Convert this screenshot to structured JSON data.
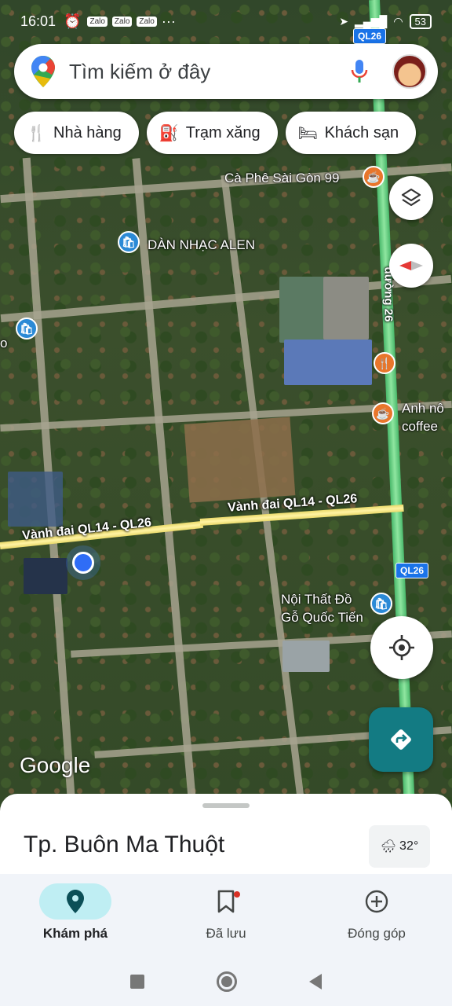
{
  "status_bar": {
    "time": "16:01",
    "apps": [
      "Zalo",
      "Zalo",
      "Zalo"
    ],
    "more": "···",
    "battery": "53"
  },
  "search": {
    "placeholder": "Tìm kiếm ở đây"
  },
  "chips": [
    {
      "label": "Nhà hàng",
      "icon": "restaurant-icon"
    },
    {
      "label": "Trạm xăng",
      "icon": "gas-station-icon"
    },
    {
      "label": "Khách sạn",
      "icon": "hotel-icon"
    }
  ],
  "map": {
    "places": {
      "cafe_saigon": "Cà Phê Sài Gòn 99",
      "dan_nhac": "DÀN NHẠC ALEN",
      "anh_no_1": "Anh nô",
      "anh_no_2": "coffee",
      "noi_that_1": "Nội Thất Đồ",
      "noi_that_2": "Gỗ Quốc Tiến",
      "left_cut": "o"
    },
    "roads": {
      "ring_left": "Vành đai QL14 - QL26",
      "ring_right": "Vành đai QL14 - QL26",
      "duong26": "đường 26",
      "ql26_top": "QL26",
      "ql26_bottom": "QL26"
    },
    "google": "Google"
  },
  "sheet": {
    "city": "Tp. Buôn Ma Thuột",
    "temperature": "32°"
  },
  "nav": [
    {
      "label": "Khám phá",
      "icon": "explore-pin-icon",
      "active": true
    },
    {
      "label": "Đã lưu",
      "icon": "bookmark-icon",
      "active": false
    },
    {
      "label": "Đóng góp",
      "icon": "add-circle-icon",
      "active": false
    }
  ],
  "colors": {
    "accent": "#137b83",
    "highway": "#49b86b",
    "active_tab_bg": "#bfeef3",
    "pin_blue": "#2b8ad6",
    "pin_orange": "#e8762b"
  }
}
